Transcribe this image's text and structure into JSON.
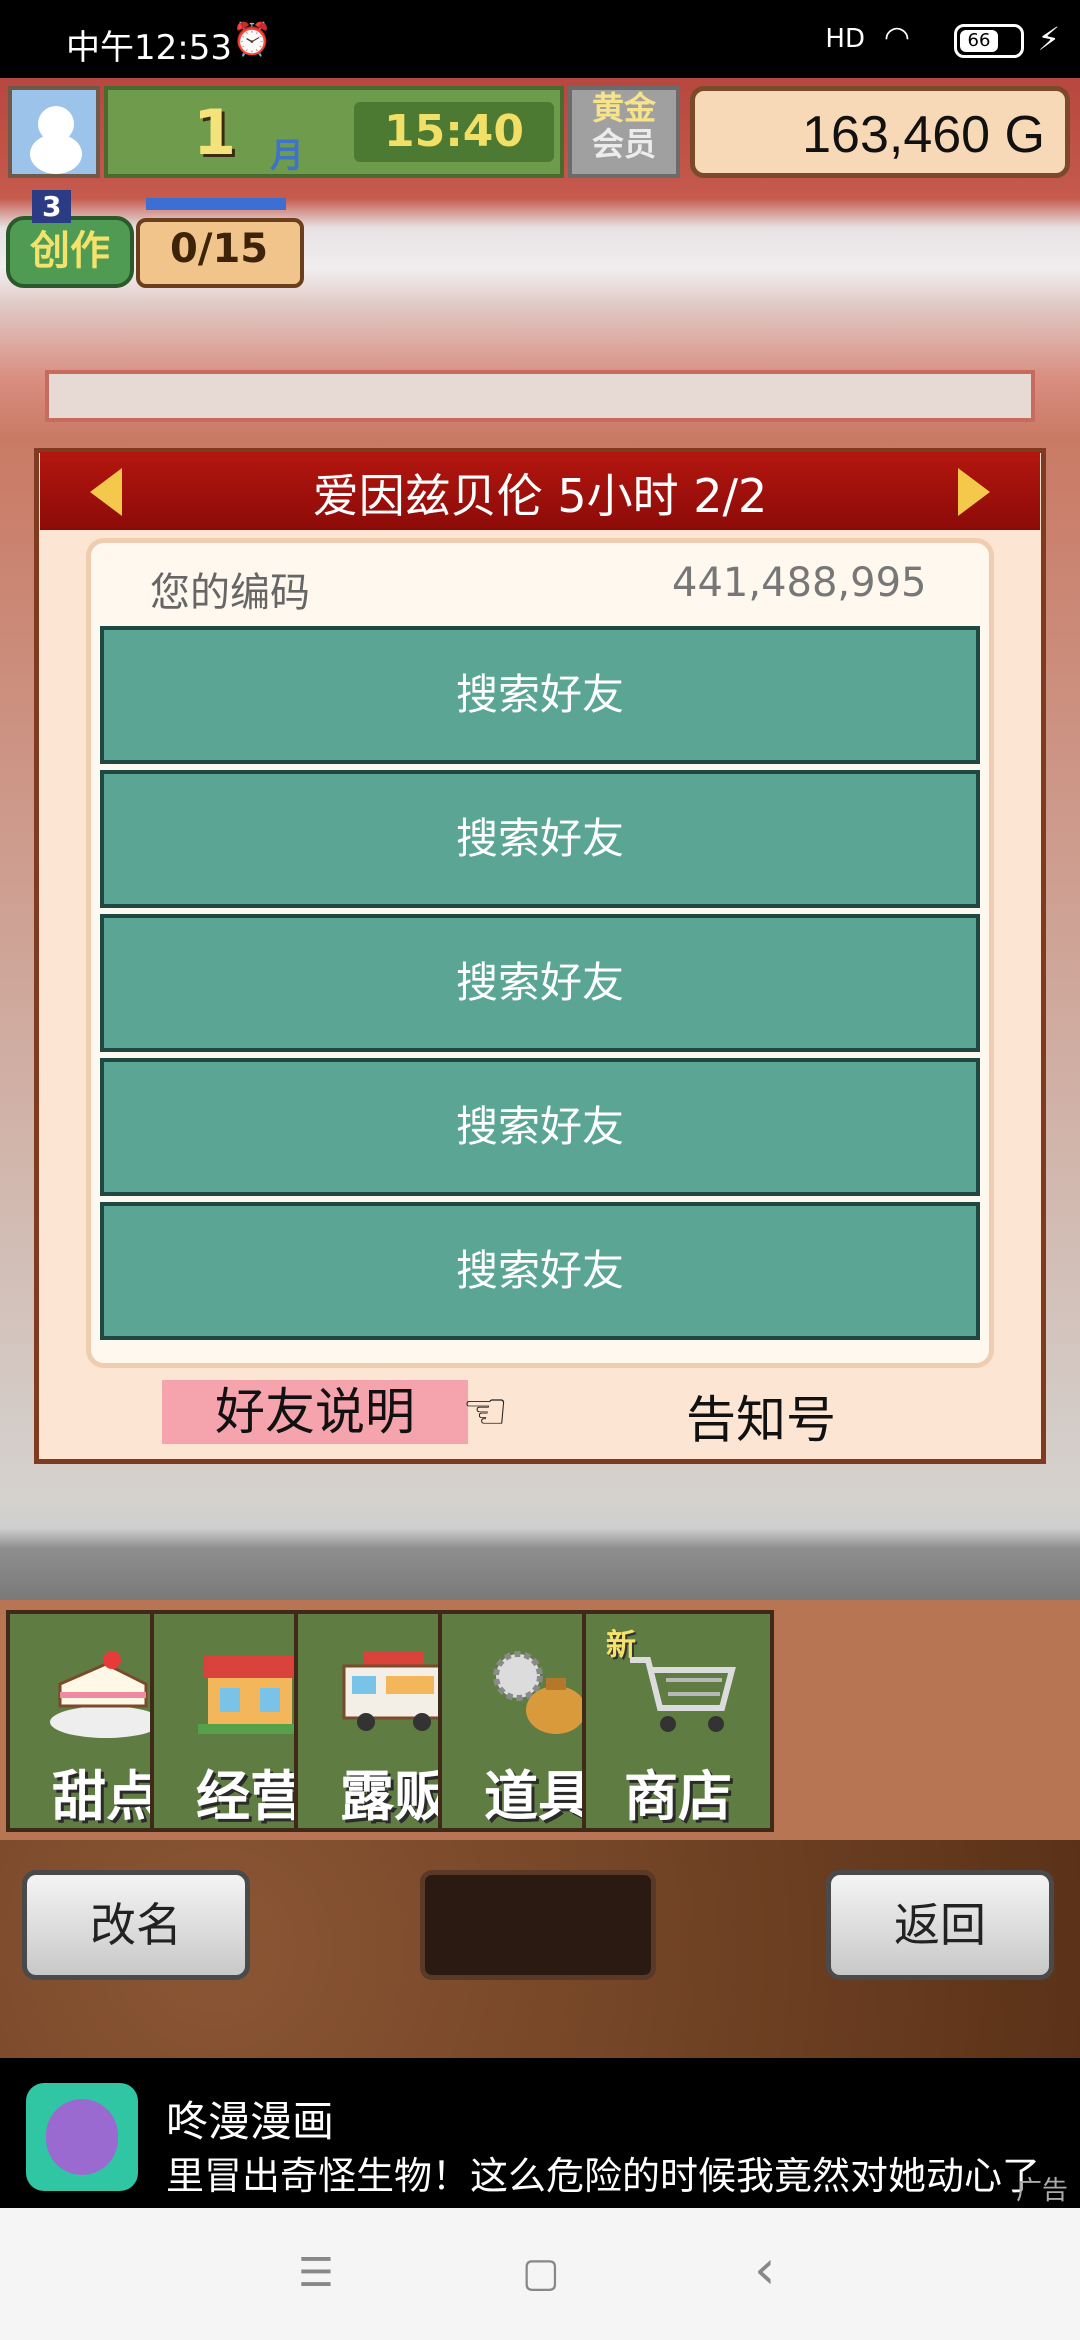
{
  "status_bar": {
    "time": "中午12:53",
    "alarm_icon": "⏰",
    "signal": "HD",
    "battery": "66"
  },
  "hud": {
    "month": "1",
    "month_label": "月",
    "clock": "15:40",
    "membership_line1": "黄金",
    "membership_line2": "会员",
    "money": "163,460",
    "currency": "G",
    "creation_label": "创作",
    "creation_level": "3",
    "creation_count": "0/15"
  },
  "dialog": {
    "title": "爱因兹贝伦 5小时 2/2",
    "code_label": "您的编码",
    "code_value": "441,488,995",
    "friend_buttons": [
      "搜索好友",
      "搜索好友",
      "搜索好友",
      "搜索好友",
      "搜索好友"
    ],
    "tab_help": "好友说明",
    "tab_notice": "告知号"
  },
  "menu": {
    "items": [
      {
        "label": "甜点",
        "icon": "cake-icon"
      },
      {
        "label": "经营",
        "icon": "shop-icon"
      },
      {
        "label": "露贩",
        "icon": "food-truck-icon"
      },
      {
        "label": "道具",
        "icon": "gear-bag-icon"
      },
      {
        "label": "商店",
        "icon": "cart-icon",
        "badge": "新"
      }
    ]
  },
  "footer": {
    "rename": "改名",
    "back": "返回"
  },
  "ad": {
    "title": "咚漫漫画",
    "text": "里冒出奇怪生物！这么危险的时候我竟然对她动心了！",
    "tag": "广告"
  },
  "navbar": {
    "menu": "☰",
    "home": "▢",
    "back": "‹"
  }
}
